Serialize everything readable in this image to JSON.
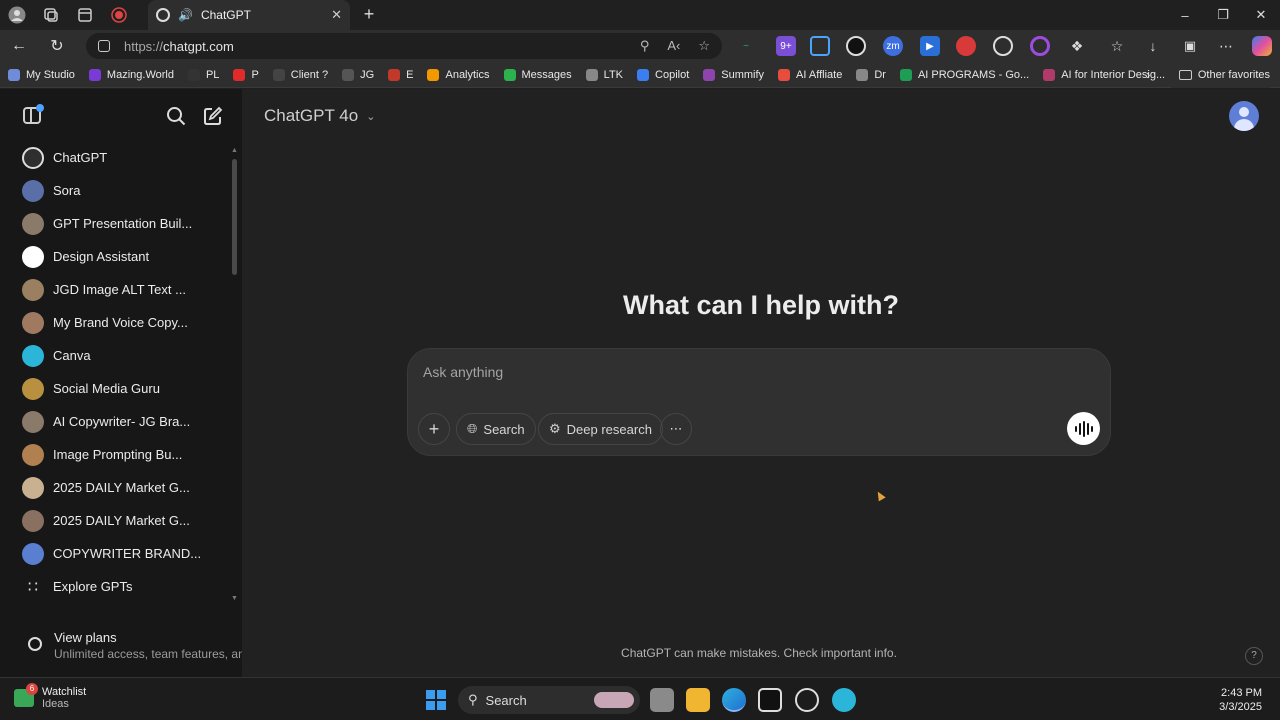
{
  "browser": {
    "tab_title": "ChatGPT",
    "url_protocol": "https://",
    "url_domain": "chatgpt.com",
    "bookmarks": [
      {
        "label": "My Studio",
        "color": "#6e8cd8"
      },
      {
        "label": "Mazing.World",
        "color": "#7a3ad6"
      },
      {
        "label": "PL",
        "color": "#333333"
      },
      {
        "label": "P",
        "color": "#e02b2b"
      },
      {
        "label": "Client ?",
        "color": "#444444"
      },
      {
        "label": "JG",
        "color": "#555555"
      },
      {
        "label": "E",
        "color": "#c0392b"
      },
      {
        "label": "Analytics",
        "color": "#f29900"
      },
      {
        "label": "Messages",
        "color": "#2bb24c"
      },
      {
        "label": "LTK",
        "color": "#888888"
      },
      {
        "label": "Copilot",
        "color": "#3b7ef0"
      },
      {
        "label": "Summify",
        "color": "#8e44ad"
      },
      {
        "label": "AI Affliate",
        "color": "#e74c3c"
      },
      {
        "label": "Dr",
        "color": "#888888"
      },
      {
        "label": "AI PROGRAMS - Go...",
        "color": "#1e9e55"
      },
      {
        "label": "AI for Interior Desig...",
        "color": "#b03a6a"
      }
    ],
    "other_favorites": "Other favorites"
  },
  "header": {
    "model_label": "ChatGPT 4o"
  },
  "sidebar": {
    "items": [
      {
        "label": "ChatGPT",
        "color": "#2f2f2f"
      },
      {
        "label": "Sora",
        "color": "#5a6fa8"
      },
      {
        "label": "GPT Presentation Buil...",
        "color": "#8a7a6a"
      },
      {
        "label": "Design Assistant",
        "color": "#ffffff"
      },
      {
        "label": "JGD Image ALT Text ...",
        "color": "#9a8060"
      },
      {
        "label": "My Brand Voice Copy...",
        "color": "#a07a60"
      },
      {
        "label": "Canva",
        "color": "#2bb5d8"
      },
      {
        "label": "Social Media Guru",
        "color": "#b89040"
      },
      {
        "label": "AI Copywriter- JG Bra...",
        "color": "#8a7a6a"
      },
      {
        "label": "Image Prompting Bu...",
        "color": "#b08050"
      },
      {
        "label": "2025 DAILY Market G...",
        "color": "#c8b090"
      },
      {
        "label": "2025 DAILY Market G...",
        "color": "#8a7060"
      },
      {
        "label": "COPYWRITER BRAND...",
        "color": "#5a7fd0"
      },
      {
        "label": "Explore GPTs",
        "color": "#171717"
      }
    ],
    "plans_title": "View plans",
    "plans_subtitle": "Unlimited access, team features, an..."
  },
  "main": {
    "heading": "What can I help with?",
    "composer_placeholder": "Ask anything",
    "search_label": "Search",
    "deep_research_label": "Deep research",
    "disclaimer": "ChatGPT can make mistakes. Check important info.",
    "help_label": "?"
  },
  "taskbar": {
    "badge_count": "6",
    "widget_title": "Watchlist",
    "widget_subtitle": "Ideas",
    "search_label": "Search",
    "time": "2:43 PM",
    "date": "3/3/2025"
  }
}
